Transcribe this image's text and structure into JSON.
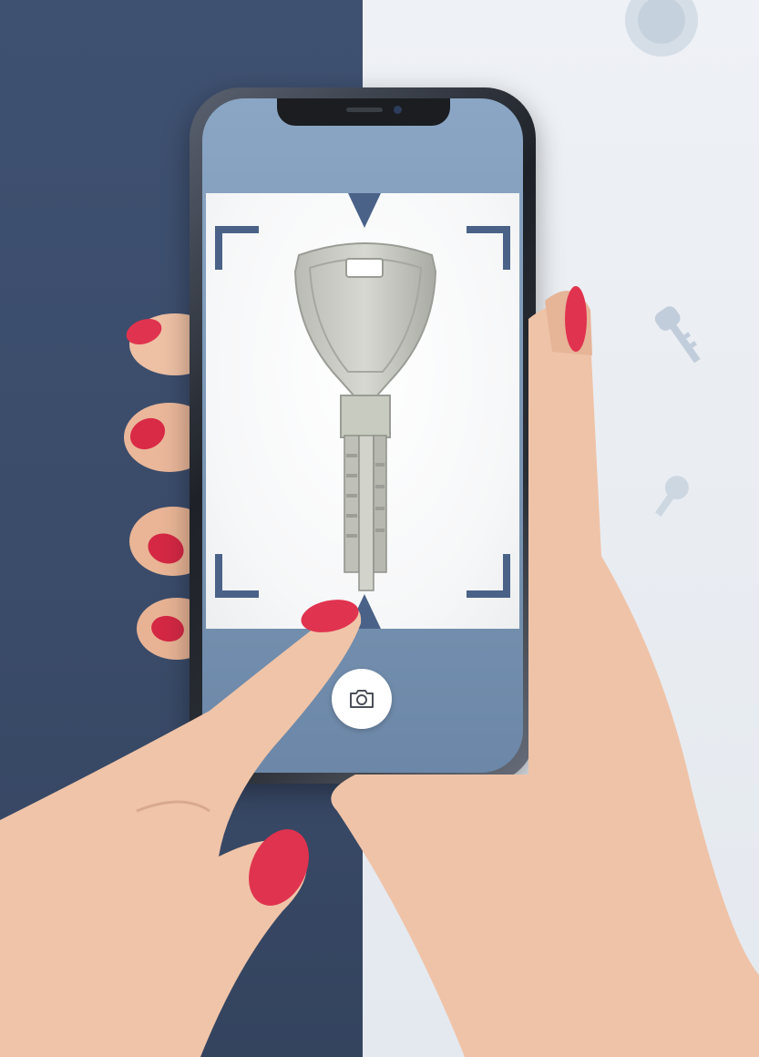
{
  "scene": {
    "subject": "key-scan-photo",
    "colors": {
      "left_background": "#3a4b69",
      "right_background": "#e6ebf1",
      "frame_accent": "#4a6288",
      "nail_polish": "#e0334f",
      "key_metal": "#c9cbc4"
    }
  },
  "app": {
    "shutter_icon": "camera-icon"
  }
}
